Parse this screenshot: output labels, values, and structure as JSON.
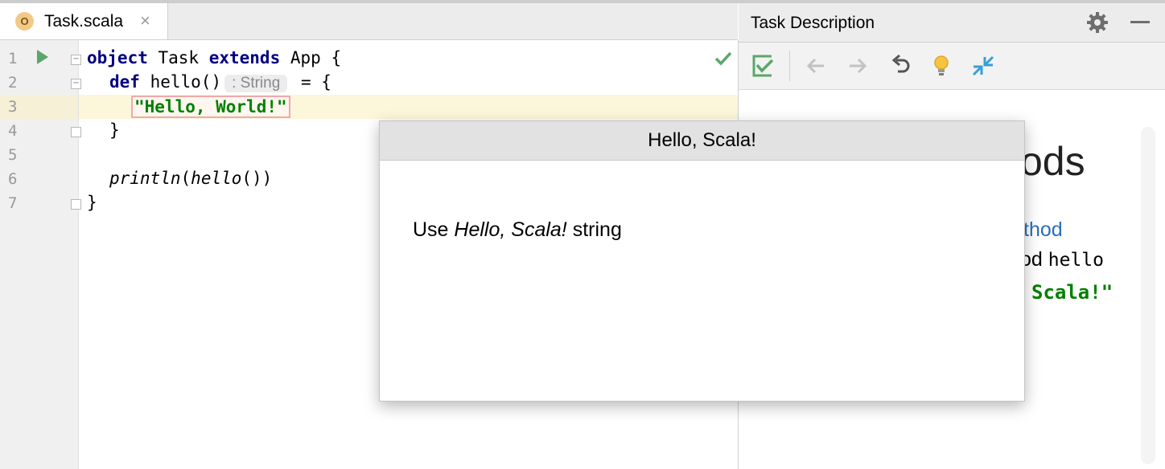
{
  "editor": {
    "tab": {
      "label": "Task.scala",
      "icon_letter": "O"
    },
    "line_numbers": [
      "1",
      "2",
      "3",
      "4",
      "5",
      "6",
      "7"
    ],
    "code": {
      "l1_kw1": "object",
      "l1_name": " Task ",
      "l1_kw2": "extends",
      "l1_rest": " App {",
      "l2_kw": "def",
      "l2_name": " hello()",
      "l2_type_hint": ": String",
      "l2_rest": " = {",
      "l3_string": "\"Hello, World!\"",
      "l4": "}",
      "l6_fn": "println",
      "l6_paren_open": "(",
      "l6_arg": "hello",
      "l6_rest": "())",
      "l7": "}"
    }
  },
  "task_panel": {
    "title": "Task Description",
    "content": {
      "heading_fragment": "ods",
      "link_fragment": "thod",
      "text_fragment_1": "od ",
      "text_fragment_code": "hello",
      "string_fragment": "Scala!\""
    }
  },
  "hint_popup": {
    "title": "Hello, Scala!",
    "body_prefix": "Use ",
    "body_italic": "Hello, Scala!",
    "body_suffix": " string"
  },
  "colors": {
    "keyword": "#000080",
    "string": "#008000",
    "run_icon": "#59a869",
    "link": "#2a6ebb"
  }
}
